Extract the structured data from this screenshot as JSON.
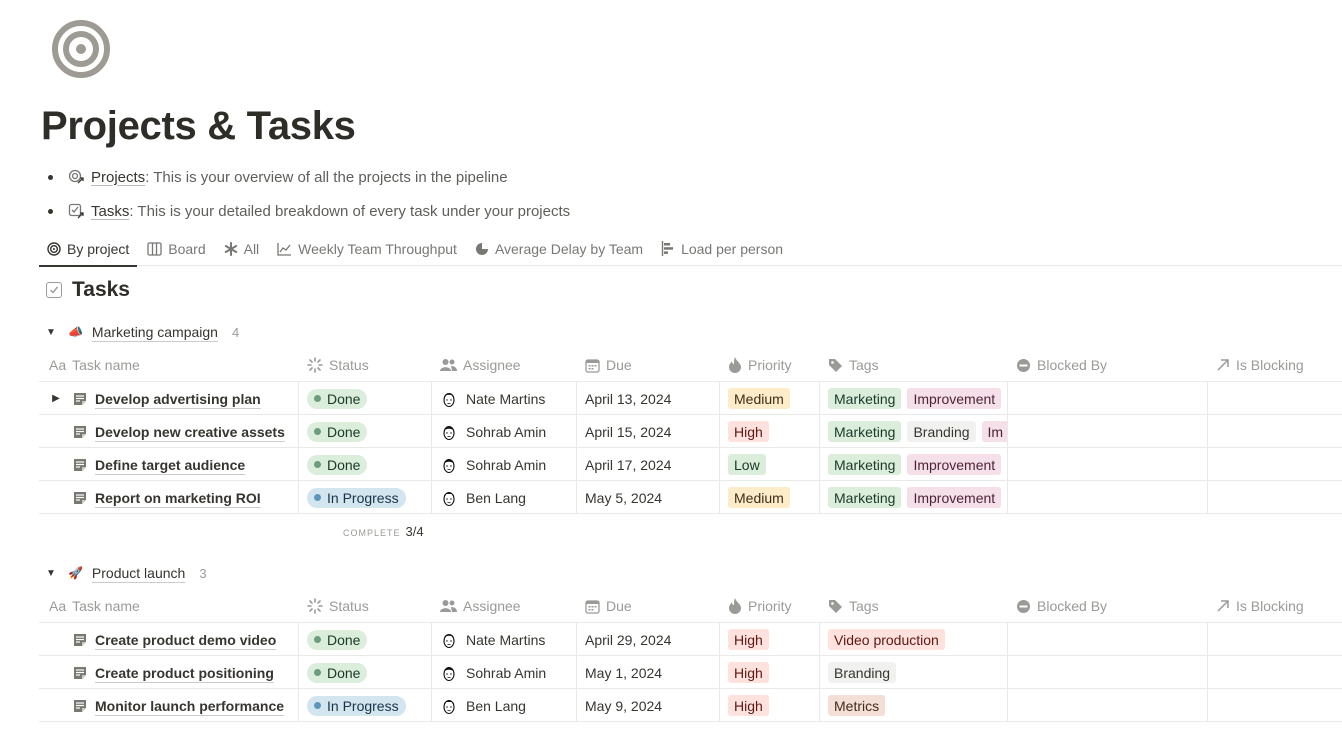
{
  "page": {
    "title": "Projects & Tasks",
    "icon": "target-icon"
  },
  "bullets": [
    {
      "link": "Projects",
      "text": ": This is your overview of all the projects in the pipeline",
      "icon": "projects-link-icon"
    },
    {
      "link": "Tasks",
      "text": ": This is your detailed breakdown of every task under your projects",
      "icon": "tasks-link-icon"
    }
  ],
  "tabs": [
    {
      "label": "By project",
      "icon": "target-icon",
      "active": true
    },
    {
      "label": "Board",
      "icon": "board-icon"
    },
    {
      "label": "All",
      "icon": "asterisk-icon"
    },
    {
      "label": "Weekly Team Throughput",
      "icon": "line-chart-icon"
    },
    {
      "label": "Average Delay by Team",
      "icon": "pie-chart-icon"
    },
    {
      "label": "Load per person",
      "icon": "bar-chart-icon"
    }
  ],
  "database": {
    "title": "Tasks",
    "icon": "checkbox-icon"
  },
  "columns": {
    "name": "Task name",
    "name_prefix": "Aa",
    "status": "Status",
    "assignee": "Assignee",
    "due": "Due",
    "priority": "Priority",
    "tags": "Tags",
    "blocked_by": "Blocked By",
    "is_blocking": "Is Blocking"
  },
  "groups": [
    {
      "name": "Marketing campaign",
      "count": "4",
      "emoji": "megaphone-icon",
      "complete_label": "COMPLETE",
      "complete_value": "3/4",
      "rows": [
        {
          "name": "Develop advertising plan",
          "expandable": true,
          "status": "Done",
          "assignee": "Nate Martins",
          "due": "April 13, 2024",
          "priority": "Medium",
          "tags": [
            "Marketing",
            "Improvement"
          ]
        },
        {
          "name": "Develop new creative assets",
          "expandable": false,
          "status": "Done",
          "assignee": "Sohrab Amin",
          "due": "April 15, 2024",
          "priority": "High",
          "tags": [
            "Marketing",
            "Branding",
            "Im"
          ]
        },
        {
          "name": "Define target audience",
          "expandable": false,
          "status": "Done",
          "assignee": "Sohrab Amin",
          "due": "April 17, 2024",
          "priority": "Low",
          "tags": [
            "Marketing",
            "Improvement"
          ]
        },
        {
          "name": "Report on marketing ROI",
          "expandable": false,
          "status": "In Progress",
          "assignee": "Ben Lang",
          "due": "May 5, 2024",
          "priority": "Medium",
          "tags": [
            "Marketing",
            "Improvement"
          ]
        }
      ]
    },
    {
      "name": "Product launch",
      "count": "3",
      "emoji": "rocket-icon",
      "rows": [
        {
          "name": "Create product demo video",
          "expandable": false,
          "status": "Done",
          "assignee": "Nate Martins",
          "due": "April 29, 2024",
          "priority": "High",
          "tags": [
            "Video production"
          ]
        },
        {
          "name": "Create product positioning",
          "expandable": false,
          "status": "Done",
          "assignee": "Sohrab Amin",
          "due": "May 1, 2024",
          "priority": "High",
          "tags": [
            "Branding"
          ]
        },
        {
          "name": "Monitor launch performance",
          "expandable": false,
          "status": "In Progress",
          "assignee": "Ben Lang",
          "due": "May 9, 2024",
          "priority": "High",
          "tags": [
            "Metrics"
          ]
        }
      ]
    }
  ],
  "colors": {
    "done": "#dbeddb",
    "in_progress": "#d3e5ef",
    "high": "#ffe2dd",
    "medium": "#fdecc8",
    "low": "#dbeddb"
  }
}
